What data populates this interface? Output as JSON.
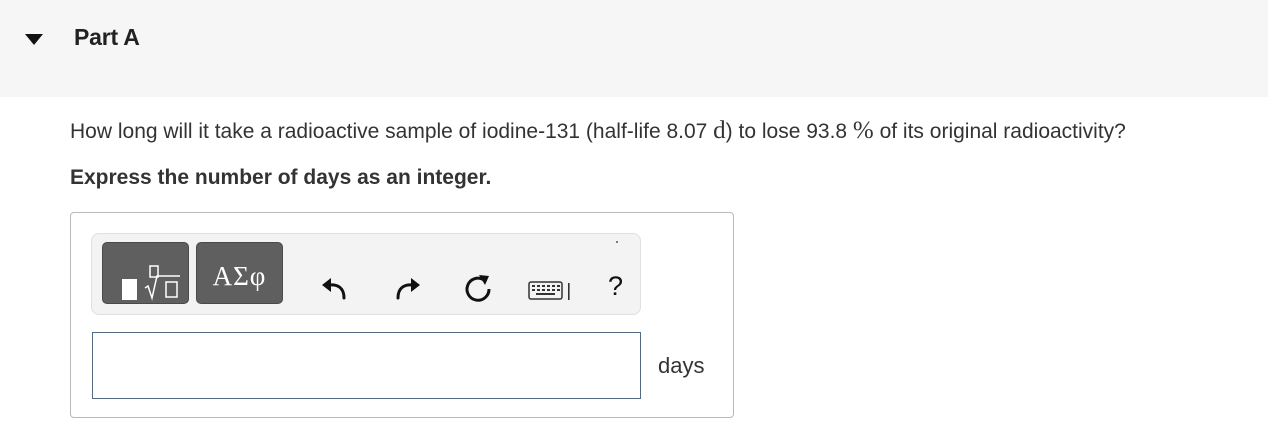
{
  "part": {
    "title": "Part A",
    "toggle_icon": "caret-down-icon"
  },
  "question": {
    "before_halflife": "How long will it take a radioactive sample of iodine-131 (half-life 8.07 ",
    "halflife_unit": "d",
    "before_percent": ") to lose 93.8 ",
    "percent_symbol": "%",
    "after_percent": " of its original radioactivity?"
  },
  "instruction": "Express the number of days as an integer.",
  "toolbar": {
    "templates_icon": "templates-fraction-root-icon",
    "greek_label": "ΑΣφ",
    "undo_icon": "undo-icon",
    "redo_icon": "redo-icon",
    "reset_icon": "reset-icon",
    "keyboard_icon": "keyboard-icon",
    "help_label": "?"
  },
  "answer": {
    "value": "",
    "placeholder": "",
    "unit": "days"
  },
  "colors": {
    "header_bg": "#f6f6f6",
    "tool_button_bg": "#5f5f5f",
    "input_border": "#3f6fa0"
  }
}
